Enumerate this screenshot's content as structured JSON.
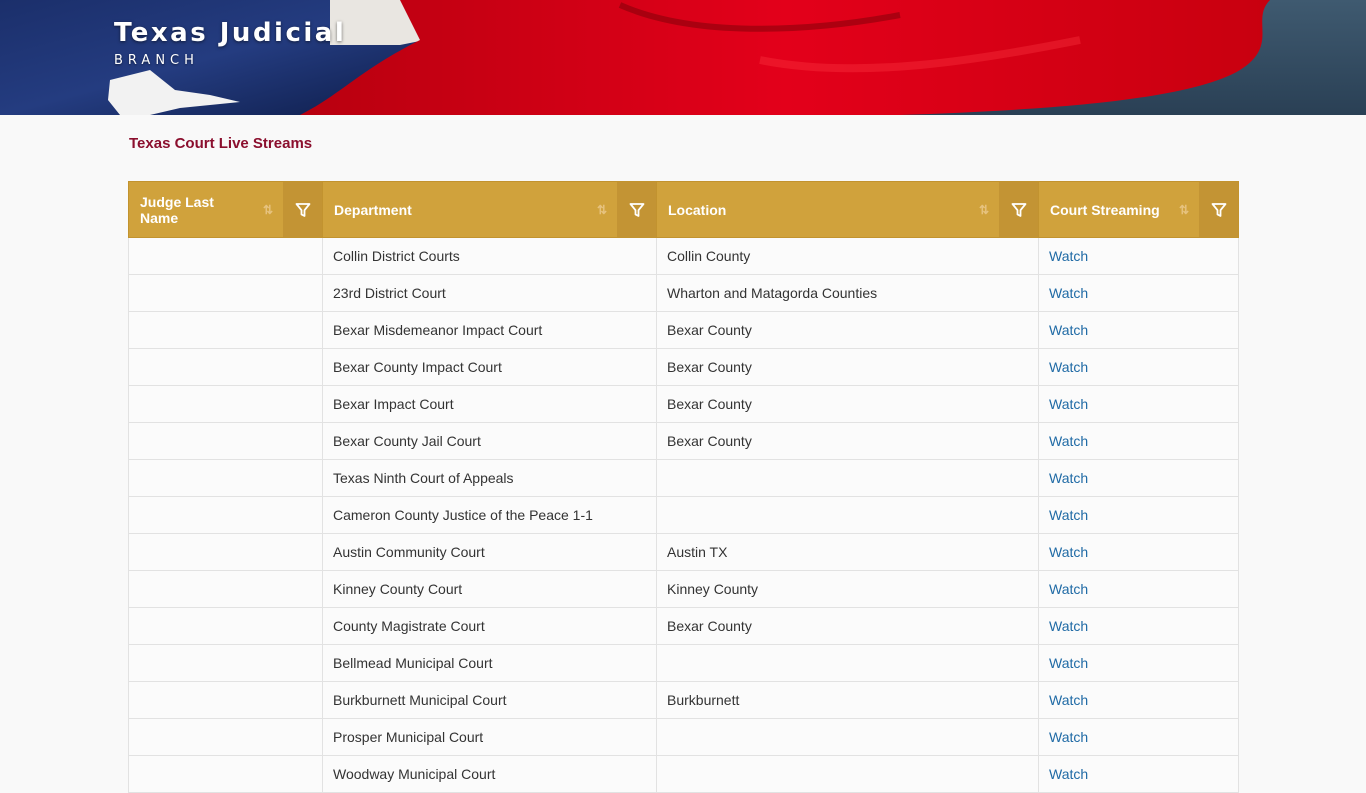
{
  "header": {
    "title": "Texas Judicial",
    "subtitle": "BRANCH"
  },
  "page": {
    "title": "Texas Court Live Streams"
  },
  "table": {
    "columns": [
      {
        "label": "Judge Last Name"
      },
      {
        "label": "Department"
      },
      {
        "label": "Location"
      },
      {
        "label": "Court Streaming"
      }
    ],
    "rows": [
      {
        "judge": "",
        "department": "Collin District Courts",
        "location": "Collin County",
        "link": "Watch"
      },
      {
        "judge": "",
        "department": "23rd District Court",
        "location": "Wharton and Matagorda Counties",
        "link": "Watch"
      },
      {
        "judge": "",
        "department": "Bexar Misdemeanor Impact Court",
        "location": "Bexar County",
        "link": "Watch"
      },
      {
        "judge": "",
        "department": "Bexar County Impact Court",
        "location": "Bexar County",
        "link": "Watch"
      },
      {
        "judge": "",
        "department": "Bexar Impact Court",
        "location": "Bexar County",
        "link": "Watch"
      },
      {
        "judge": "",
        "department": "Bexar County Jail Court",
        "location": "Bexar County",
        "link": "Watch"
      },
      {
        "judge": "",
        "department": "Texas Ninth Court of Appeals",
        "location": "",
        "link": "Watch"
      },
      {
        "judge": "",
        "department": "Cameron County Justice of the Peace 1-1",
        "location": "",
        "link": "Watch"
      },
      {
        "judge": "",
        "department": "Austin Community Court",
        "location": "Austin TX",
        "link": "Watch"
      },
      {
        "judge": "",
        "department": "Kinney County Court",
        "location": "Kinney County",
        "link": "Watch"
      },
      {
        "judge": "",
        "department": "County Magistrate Court",
        "location": "Bexar County",
        "link": "Watch"
      },
      {
        "judge": "",
        "department": "Bellmead Municipal Court",
        "location": "",
        "link": "Watch"
      },
      {
        "judge": "",
        "department": "Burkburnett Municipal Court",
        "location": "Burkburnett",
        "link": "Watch"
      },
      {
        "judge": "",
        "department": "Prosper Municipal Court",
        "location": "",
        "link": "Watch"
      },
      {
        "judge": "",
        "department": "Woodway Municipal Court",
        "location": "",
        "link": "Watch"
      }
    ]
  },
  "icons": {
    "sort": "sort-icon",
    "filter": "filter-icon"
  },
  "colors": {
    "header_gold": "#d0a23c",
    "title_maroon": "#8b0f2e",
    "link_blue": "#1f6aa5"
  }
}
